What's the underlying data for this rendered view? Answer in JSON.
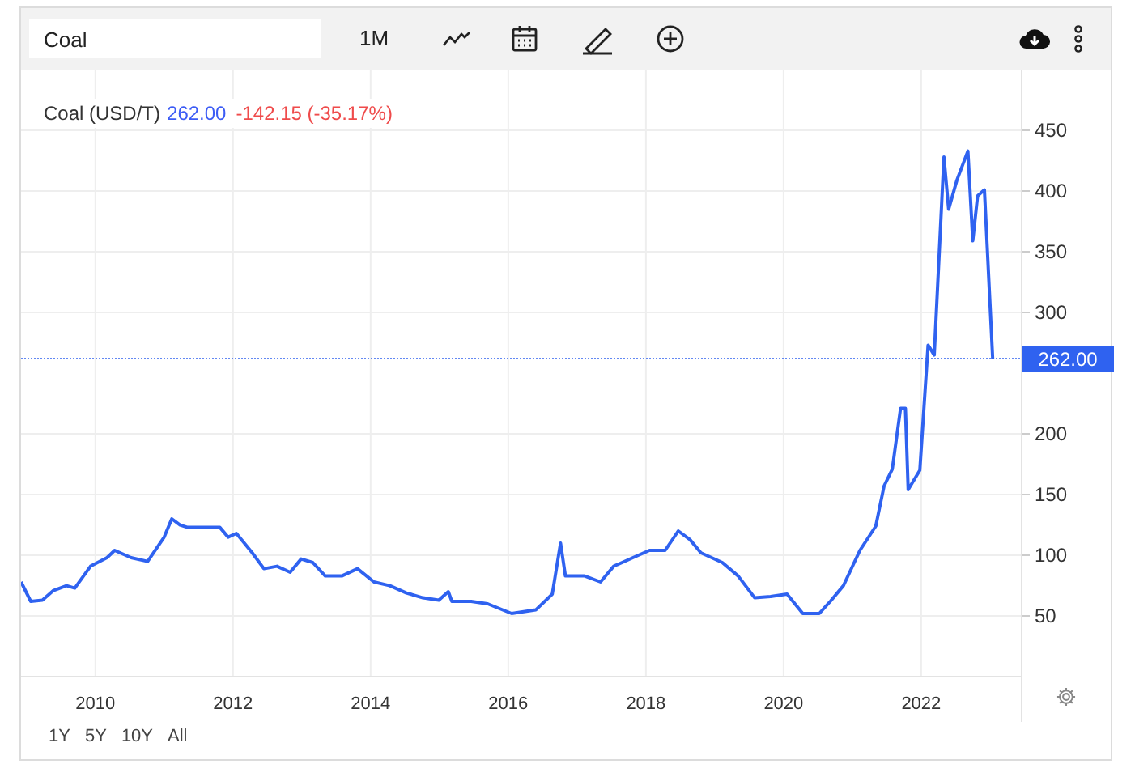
{
  "toolbar": {
    "search": {
      "value": "Coal"
    },
    "interval": "1M"
  },
  "legend": {
    "price": "262.00",
    "change": "-142.15 (-35.17%)"
  },
  "price_tag": "262.00",
  "chart_data": {
    "type": "line",
    "grid": true,
    "ref_lines": [
      {
        "axis": "y",
        "value": 262,
        "color": "#2f62f0"
      }
    ],
    "xlim": [
      2008.92,
      2023.46
    ],
    "ylim": [
      0,
      500
    ],
    "xticks": [
      2010,
      2012,
      2014,
      2016,
      2018,
      2020,
      2022
    ],
    "yticks": [
      50,
      100,
      150,
      200,
      300,
      350,
      400,
      450
    ],
    "x": [
      2008.92,
      2009.06,
      2009.23,
      2009.39,
      2009.58,
      2009.7,
      2009.93,
      2010.17,
      2010.28,
      2010.52,
      2010.76,
      2011.0,
      2011.11,
      2011.23,
      2011.34,
      2011.58,
      2011.81,
      2011.93,
      2012.05,
      2012.28,
      2012.45,
      2012.64,
      2012.83,
      2012.99,
      2013.16,
      2013.34,
      2013.58,
      2013.81,
      2014.05,
      2014.28,
      2014.52,
      2014.76,
      2014.99,
      2015.13,
      2015.18,
      2015.46,
      2015.7,
      2016.05,
      2016.4,
      2016.64,
      2016.76,
      2016.83,
      2017.11,
      2017.34,
      2017.53,
      2017.81,
      2018.05,
      2018.28,
      2018.47,
      2018.64,
      2018.8,
      2019.11,
      2019.34,
      2019.58,
      2019.81,
      2020.05,
      2020.28,
      2020.52,
      2020.68,
      2020.87,
      2021.11,
      2021.34,
      2021.46,
      2021.58,
      2021.7,
      2021.77,
      2021.81,
      2021.98,
      2022.1,
      2022.19,
      2022.33,
      2022.4,
      2022.52,
      2022.68,
      2022.75,
      2022.82,
      2022.92,
      2023.04
    ],
    "series": [
      {
        "name": "Coal (USD/T)",
        "color": "#2f62f0",
        "values": [
          78,
          62,
          63,
          71,
          75,
          73,
          91,
          98,
          104,
          98,
          95,
          115,
          130,
          125,
          123,
          123,
          123,
          115,
          118,
          102,
          89,
          91,
          86,
          97,
          94,
          83,
          83,
          89,
          78,
          75,
          69,
          65,
          63,
          70,
          62,
          62,
          60,
          52,
          55,
          68,
          110,
          83,
          83,
          78,
          91,
          98,
          104,
          104,
          120,
          113,
          102,
          94,
          83,
          65,
          66,
          68,
          52,
          52,
          62,
          75,
          104,
          124,
          157,
          171,
          221,
          221,
          154,
          170,
          273,
          265,
          428,
          385,
          409,
          433,
          359,
          396,
          401,
          262
        ]
      }
    ]
  },
  "ranges": [
    {
      "label": "1Y"
    },
    {
      "label": "5Y"
    },
    {
      "label": "10Y"
    },
    {
      "label": "All"
    }
  ]
}
